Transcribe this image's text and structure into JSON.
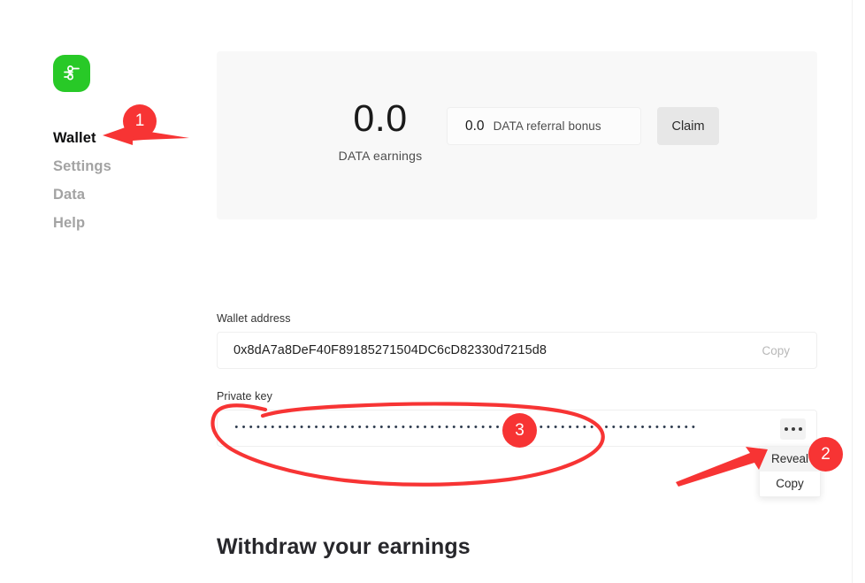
{
  "app": {
    "logo_icon": "streamr-logo-icon",
    "brand_color": "#28c927"
  },
  "sidebar": {
    "items": [
      {
        "label": "Wallet",
        "active": true
      },
      {
        "label": "Settings",
        "active": false
      },
      {
        "label": "Data",
        "active": false
      },
      {
        "label": "Help",
        "active": false
      }
    ]
  },
  "earnings_card": {
    "earnings_value": "0.0",
    "earnings_label": "DATA earnings",
    "referral_value": "0.0",
    "referral_label": "DATA referral bonus",
    "claim_label": "Claim"
  },
  "wallet_address": {
    "label": "Wallet address",
    "value": "0x8dA7a8DeF40F89185271504DC6cD82330d7215d8",
    "copy_label": "Copy"
  },
  "private_key": {
    "label": "Private key",
    "masked_value": "••••••••••••••••••••••••••••••••••••••••••••••••••••••••••••••••",
    "menu_icon": "ellipsis-horizontal-icon",
    "menu_items": [
      {
        "label": "Reveal",
        "hovered": true
      },
      {
        "label": "Copy",
        "hovered": false
      }
    ]
  },
  "withdraw_section": {
    "heading": "Withdraw your earnings"
  },
  "annotations": {
    "color": "#f73434",
    "markers": [
      {
        "number": "1",
        "target": "sidebar-item-wallet"
      },
      {
        "number": "2",
        "target": "private-key-menu-reveal"
      },
      {
        "number": "3",
        "target": "private-key-field"
      }
    ]
  }
}
